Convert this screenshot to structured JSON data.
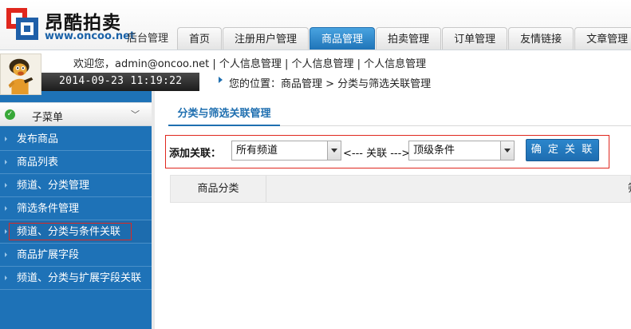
{
  "header": {
    "brand_name": "昂酷拍卖",
    "brand_url": "www.oncoo.net",
    "admin_label": "后台管理",
    "nav_tabs": [
      {
        "label": "首页"
      },
      {
        "label": "注册用户管理"
      },
      {
        "label": "商品管理",
        "active": true
      },
      {
        "label": "拍卖管理"
      },
      {
        "label": "订单管理"
      },
      {
        "label": "友情链接"
      },
      {
        "label": "文章管理"
      }
    ]
  },
  "topbar": {
    "welcome": "欢迎您，admin@oncoo.net | 个人信息管理 | 个人信息管理 | 个人信息管理",
    "datetime": "2014-09-23 11:19:22",
    "breadcrumb": "您的位置：商品管理 > 分类与筛选关联管理"
  },
  "sidebar": {
    "title": "子菜单",
    "items": [
      {
        "label": "发布商品"
      },
      {
        "label": "商品列表"
      },
      {
        "label": "频道、分类管理"
      },
      {
        "label": "筛选条件管理"
      },
      {
        "label": "频道、分类与条件关联",
        "selected": true
      },
      {
        "label": "商品扩展字段"
      },
      {
        "label": "频道、分类与扩展字段关联"
      }
    ]
  },
  "main": {
    "subtab": "分类与筛选关联管理",
    "form": {
      "add_label": "添加关联：",
      "channel_value": "所有频道",
      "relation_text": "<--- 关联 --->",
      "condition_value": "顶级条件",
      "confirm_label": "确 定 关 联"
    },
    "table": {
      "columns": [
        "商品分类",
        "筛"
      ]
    }
  },
  "colors": {
    "brand_blue": "#1e72b7",
    "active_tab": "#2e8ad0",
    "highlight_red": "#e0271e",
    "button_blue": "#1e6db0"
  }
}
